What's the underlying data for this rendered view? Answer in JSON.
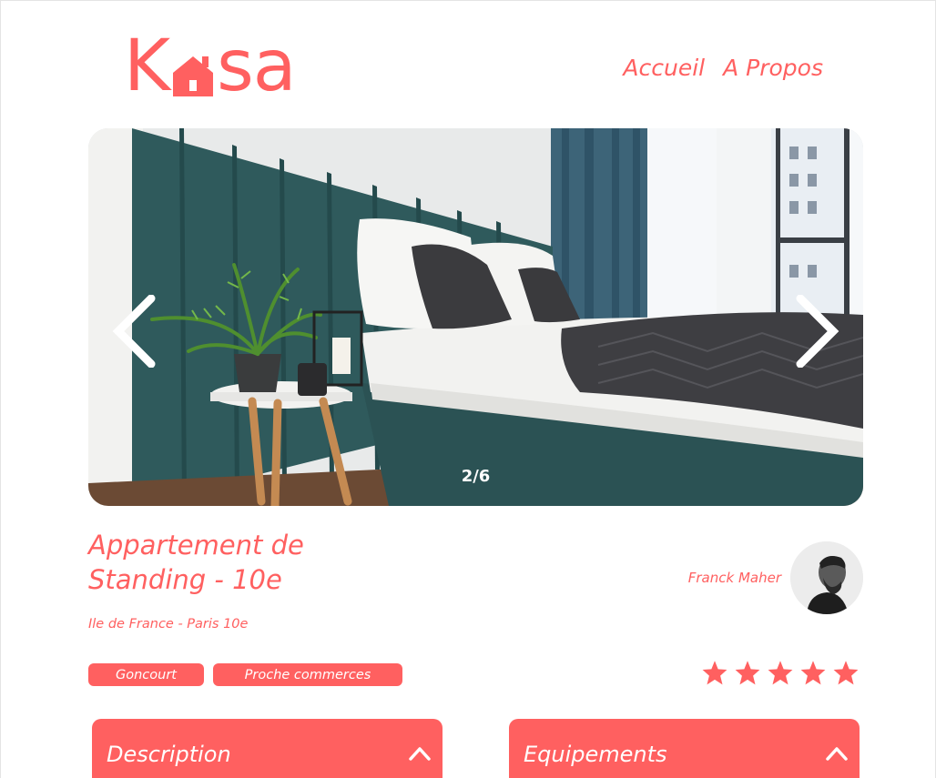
{
  "brand": {
    "logo_letters_left": "K",
    "logo_letters_right": "sa",
    "logo_text": "Kasa",
    "color": "#ff6060"
  },
  "nav": {
    "items": [
      {
        "label": "Accueil"
      },
      {
        "label": "A Propos"
      }
    ]
  },
  "carousel": {
    "counter": "2/6",
    "prev_icon": "chevron-left-icon",
    "next_icon": "chevron-right-icon"
  },
  "listing": {
    "title": "Appartement de Standing - 10e",
    "location": "Ile de France - Paris 10e",
    "tags": [
      {
        "label": "Goncourt"
      },
      {
        "label": "Proche commerces"
      }
    ],
    "rating": 5,
    "rating_max": 5
  },
  "host": {
    "name": "Franck Maher"
  },
  "collapses": [
    {
      "title": "Description",
      "icon": "chevron-up-icon"
    },
    {
      "title": "Equipements",
      "icon": "chevron-up-icon"
    }
  ]
}
